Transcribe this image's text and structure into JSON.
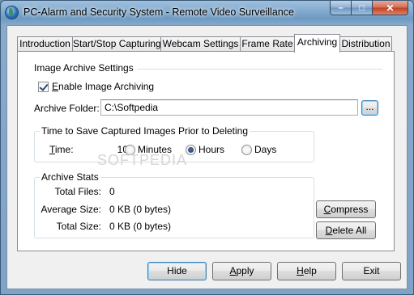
{
  "window": {
    "title": "PC-Alarm and Security System - Remote Video Surveillance",
    "minimize": "–",
    "maximize": "□",
    "close": "✕"
  },
  "tabs": [
    {
      "label": "Introduction"
    },
    {
      "label": "Start/Stop Capturing"
    },
    {
      "label": "Webcam Settings"
    },
    {
      "label": "Frame Rate"
    },
    {
      "label": "Archiving",
      "active": true
    },
    {
      "label": "Distribution"
    }
  ],
  "archive_settings": {
    "section_title": "Image Archive Settings",
    "enable_label": "Enable Image Archiving",
    "enable_checked": true,
    "folder_label": "Archive Folder:",
    "folder_value": "C:\\Softpedia",
    "browse_label": "..."
  },
  "retention": {
    "group_title": "Time to Save Captured Images Prior to Deleting",
    "time_label": "Time:",
    "time_value": "10",
    "units": [
      {
        "label": "Minutes",
        "selected": false
      },
      {
        "label": "Hours",
        "selected": true
      },
      {
        "label": "Days",
        "selected": false
      }
    ]
  },
  "stats": {
    "group_title": "Archive Stats",
    "rows": [
      {
        "label": "Total Files:",
        "value": "0"
      },
      {
        "label": "Average Size:",
        "value": "0 KB (0 bytes)"
      },
      {
        "label": "Total Size:",
        "value": "0 KB (0 bytes)"
      }
    ]
  },
  "side_buttons": {
    "compress": "Compress",
    "delete_all": "Delete All"
  },
  "footer_buttons": {
    "hide": "Hide",
    "apply": "Apply",
    "help": "Help",
    "exit": "Exit"
  },
  "watermark": "SOFTPEDIA"
}
